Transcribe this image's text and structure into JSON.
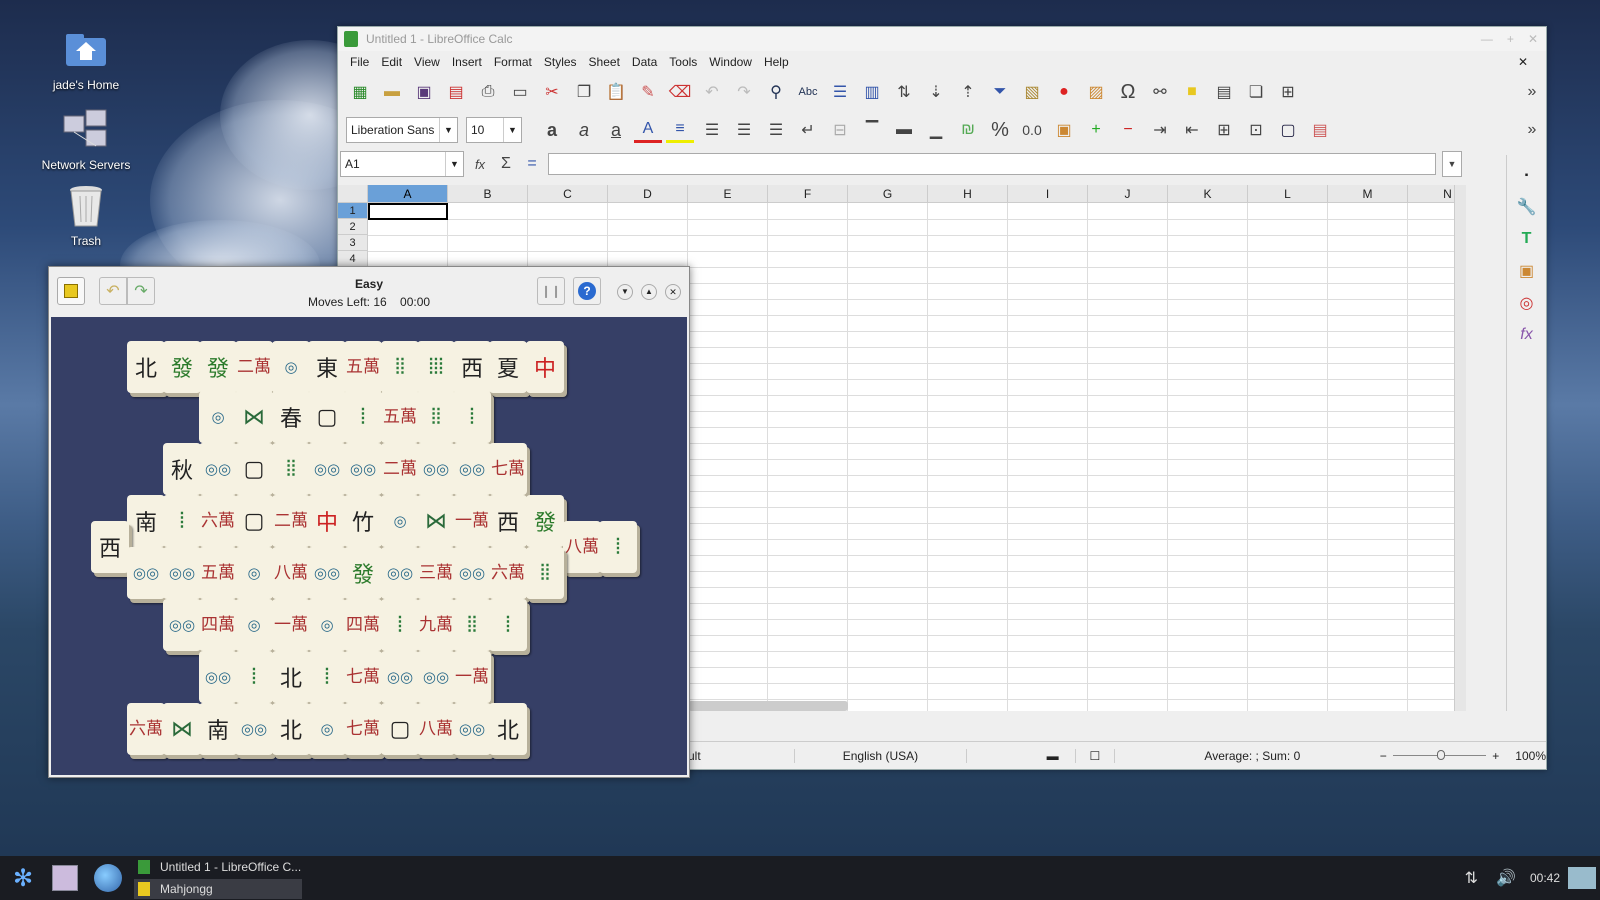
{
  "desktop": {
    "icons": [
      {
        "label": "jade's Home"
      },
      {
        "label": "Network Servers"
      },
      {
        "label": "Trash"
      }
    ]
  },
  "calc": {
    "title": "Untitled 1 - LibreOffice Calc",
    "menu": [
      "File",
      "Edit",
      "View",
      "Insert",
      "Format",
      "Styles",
      "Sheet",
      "Data",
      "Tools",
      "Window",
      "Help"
    ],
    "font_name": "Liberation Sans",
    "font_size": "10",
    "name_box": "A1",
    "columns": [
      "A",
      "B",
      "C",
      "D",
      "E",
      "F",
      "G",
      "H",
      "I",
      "J",
      "K",
      "L",
      "M",
      "N"
    ],
    "rows": [
      "1",
      "2",
      "3",
      "4"
    ],
    "status": {
      "style": "ult",
      "language": "English (USA)",
      "summary": "Average: ; Sum: 0",
      "zoom": "100%"
    },
    "number_format_label": "0.0"
  },
  "mahjongg": {
    "title": "Easy",
    "moves_left": "Moves Left: 16",
    "time": "00:00",
    "tiles": [
      "北",
      "發",
      "發",
      "二萬",
      "◎",
      "東",
      "五萬",
      "⦙⦙",
      "⦙⦙⦙",
      "西",
      "夏",
      "中",
      "◎",
      "⋈",
      "春",
      "▢",
      "⦙",
      "五萬",
      "⦙⦙",
      "⦙",
      "秋",
      "◎◎",
      "▢",
      "⦙⦙",
      "◎◎",
      "◎◎",
      "二萬",
      "◎◎",
      "◎◎",
      "七萬",
      "南",
      "⦙",
      "六萬",
      "▢",
      "二萬",
      "中",
      "竹",
      "◎",
      "⋈",
      "一萬",
      "西",
      "發",
      "西",
      "八萬",
      "⦙",
      "◎◎",
      "◎◎",
      "五萬",
      "◎",
      "八萬",
      "◎◎",
      "發",
      "◎◎",
      "三萬",
      "◎◎",
      "六萬",
      "⦙⦙",
      "◎◎",
      "四萬",
      "◎",
      "一萬",
      "◎",
      "四萬",
      "⦙",
      "九萬",
      "⦙⦙",
      "⦙",
      "◎◎",
      "⦙",
      "北",
      "⦙",
      "七萬",
      "◎◎",
      "◎◎",
      "一萬",
      "六萬",
      "⋈",
      "南",
      "◎◎",
      "北",
      "◎",
      "七萬",
      "▢",
      "八萬",
      "◎◎",
      "北"
    ]
  },
  "taskbar": {
    "tasks": [
      "Untitled 1 - LibreOffice C...",
      "Mahjongg"
    ],
    "clock": "00:42"
  }
}
